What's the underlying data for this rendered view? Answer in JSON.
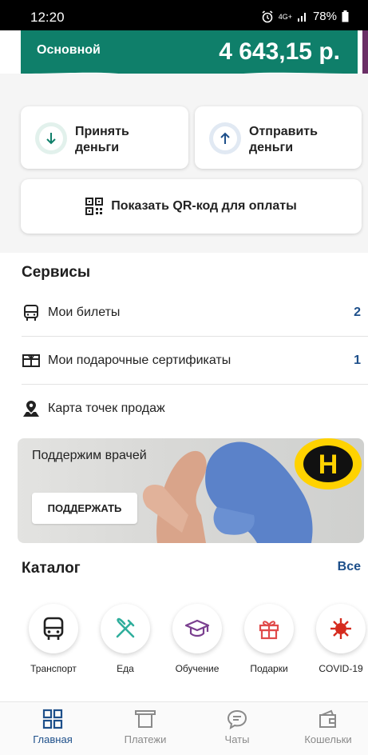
{
  "status": {
    "time": "12:20",
    "network": "4G+",
    "battery": "78%"
  },
  "wallet": {
    "name": "Основной",
    "balance": "4 643,15 р."
  },
  "actions": {
    "receive": "Принять\nденьги",
    "send": "Отправить\nденьги",
    "qr": "Показать QR-код для оплаты"
  },
  "services": {
    "title": "Сервисы",
    "items": [
      {
        "label": "Мои билеты",
        "count": "2",
        "icon": "bus-icon"
      },
      {
        "label": "Мои подарочные сертификаты",
        "count": "1",
        "icon": "certificate-icon"
      },
      {
        "label": "Карта точек продаж",
        "count": "",
        "icon": "map-pin-icon"
      }
    ]
  },
  "banner": {
    "text": "Поддержим врачей",
    "button": "ПОДДЕРЖАТЬ",
    "logo": "Н"
  },
  "catalog": {
    "title": "Каталог",
    "all": "Все",
    "items": [
      {
        "label": "Транспорт",
        "icon": "bus-icon",
        "color": "#222222"
      },
      {
        "label": "Еда",
        "icon": "fork-knife-icon",
        "color": "#2fae9c"
      },
      {
        "label": "Обучение",
        "icon": "graduation-cap-icon",
        "color": "#7a3f8f"
      },
      {
        "label": "Подарки",
        "icon": "gift-icon",
        "color": "#e04a4a"
      },
      {
        "label": "COVID-19",
        "icon": "virus-icon",
        "color": "#d52b1e"
      }
    ]
  },
  "nav": {
    "items": [
      {
        "label": "Главная",
        "icon": "grid-icon",
        "active": true
      },
      {
        "label": "Платежи",
        "icon": "payments-icon",
        "active": false
      },
      {
        "label": "Чаты",
        "icon": "chat-icon",
        "active": false
      },
      {
        "label": "Кошельки",
        "icon": "wallet-icon",
        "active": false
      }
    ]
  },
  "colors": {
    "accent": "#1d4f8a",
    "wallet_bg": "#0f7f6a"
  }
}
